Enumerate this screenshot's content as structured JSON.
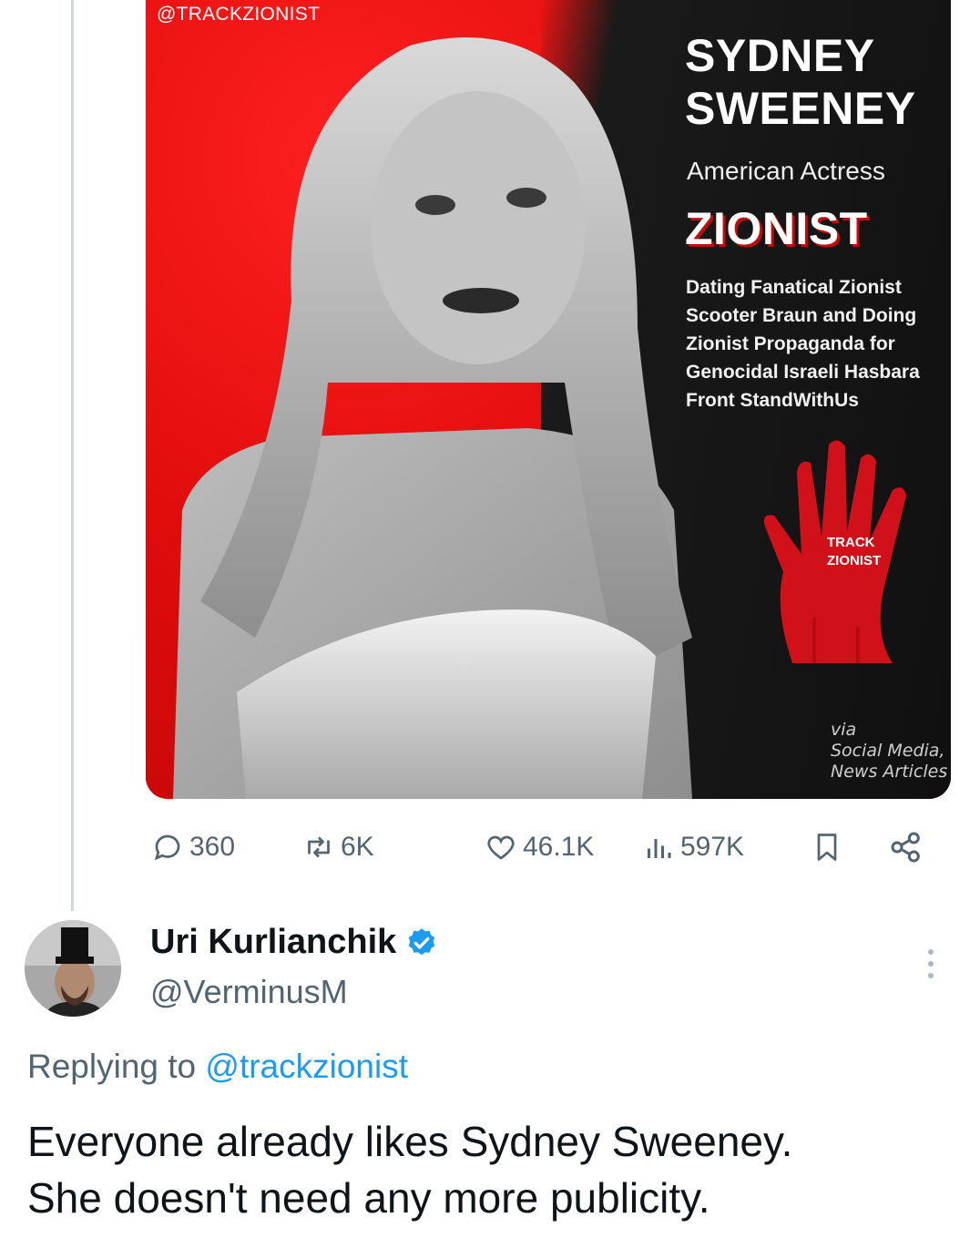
{
  "media": {
    "handle_tag": "@TRACKZIONIST",
    "name_line1": "SYDNEY",
    "name_line2": "SWEENEY",
    "subtitle": "American Actress",
    "label": "ZIONIST",
    "description": "Dating Fanatical Zionist Scooter Braun and Doing Zionist Propaganda for Genocidal Israeli Hasbara Front StandWithUs",
    "hand_label_line1": "TRACK",
    "hand_label_line2": "ZIONIST",
    "via_line1": "via",
    "via_line2": "Social Media,",
    "via_line3": "News Articles",
    "colors": {
      "red": "#e00d0d",
      "dark": "#151515"
    }
  },
  "actions": {
    "replies": "360",
    "reposts": "6K",
    "likes": "46.1K",
    "views": "597K",
    "icons": [
      "reply-icon",
      "repost-icon",
      "like-icon",
      "views-icon",
      "bookmark-icon",
      "share-icon"
    ]
  },
  "reply": {
    "display_name": "Uri Kurlianchik",
    "handle": "@VerminusM",
    "replying_prefix": "Replying to",
    "replying_mention": "@trackzionist",
    "text_line1": "Everyone already likes Sydney Sweeney.",
    "text_line2": "She doesn't need any more publicity.",
    "colors": {
      "link": "#1d9bf0",
      "muted": "#536471",
      "verified": "#1d9bf0"
    }
  }
}
